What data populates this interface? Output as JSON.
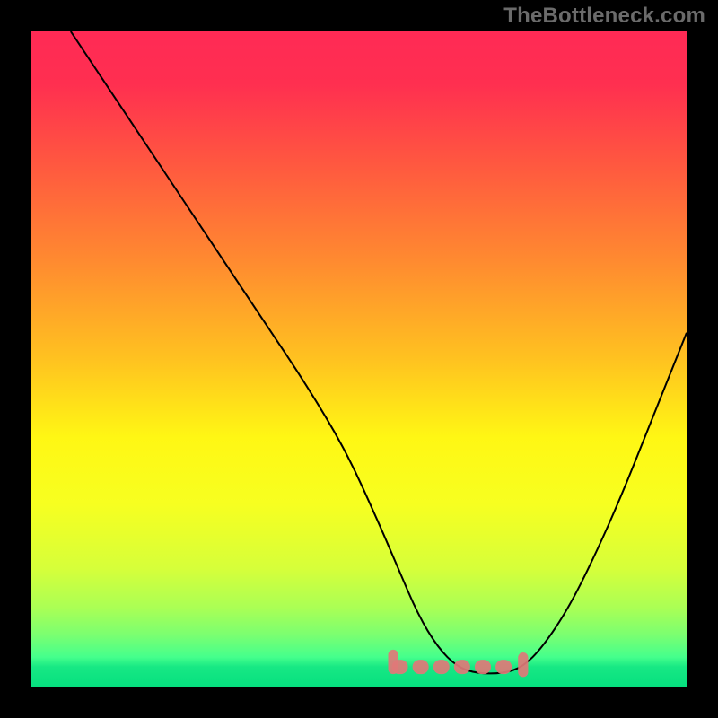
{
  "attribution": "TheBottleneck.com",
  "chart_data": {
    "type": "line",
    "title": "",
    "xlabel": "",
    "ylabel": "",
    "xlim": [
      0,
      100
    ],
    "ylim": [
      0,
      100
    ],
    "gradient_stops": [
      {
        "offset": 0.0,
        "color": "#ff2a55"
      },
      {
        "offset": 0.08,
        "color": "#ff2f50"
      },
      {
        "offset": 0.2,
        "color": "#ff5740"
      },
      {
        "offset": 0.35,
        "color": "#ff8a30"
      },
      {
        "offset": 0.5,
        "color": "#ffc220"
      },
      {
        "offset": 0.62,
        "color": "#fff714"
      },
      {
        "offset": 0.72,
        "color": "#f7ff20"
      },
      {
        "offset": 0.82,
        "color": "#d6ff3a"
      },
      {
        "offset": 0.88,
        "color": "#aaff55"
      },
      {
        "offset": 0.92,
        "color": "#7cff70"
      },
      {
        "offset": 0.955,
        "color": "#45ff8c"
      },
      {
        "offset": 0.97,
        "color": "#17e884"
      },
      {
        "offset": 1.0,
        "color": "#06e07f"
      }
    ],
    "curve": {
      "x": [
        6,
        12,
        18,
        24,
        30,
        36,
        42,
        48,
        53,
        56,
        59,
        62,
        65,
        68,
        72,
        75,
        78,
        82,
        86,
        90,
        94,
        98,
        100
      ],
      "y": [
        100,
        91,
        82,
        73,
        64,
        55,
        46,
        36,
        25,
        18,
        11,
        6,
        3,
        2,
        2,
        3,
        6,
        12,
        20,
        29,
        39,
        49,
        54
      ]
    },
    "flat_band": {
      "x_start": 55,
      "x_end": 74,
      "y": 3,
      "color": "#e07878",
      "thickness": 2.2
    },
    "line_color": "#000000",
    "line_width": 0.25
  }
}
